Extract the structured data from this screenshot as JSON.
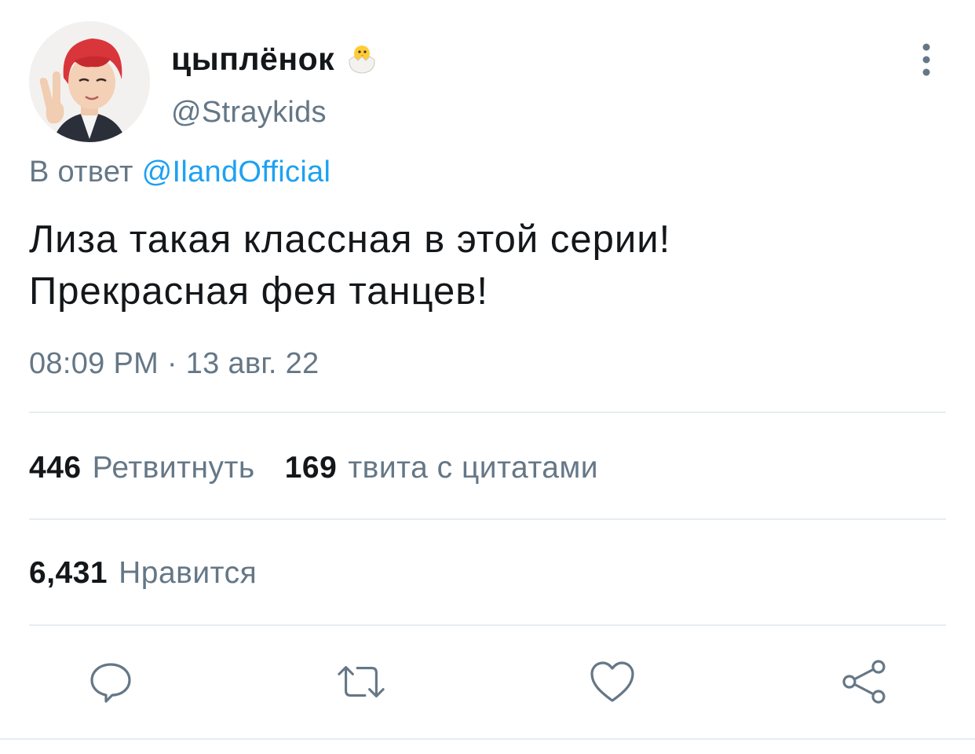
{
  "author": {
    "display_name": "цыплёнок",
    "emoji_icon": "hatching-chick-icon",
    "handle": "@Straykids"
  },
  "reply": {
    "prefix": "В ответ",
    "mention": "@IlandOfficial"
  },
  "tweet": {
    "text_line1": "Лиза такая классная в этой серии!",
    "text_line2": "Прекрасная фея танцев!",
    "timestamp": "08:09 PM · 13 авг. 22"
  },
  "stats": {
    "retweets_count": "446",
    "retweets_label": "Ретвитнуть",
    "quotes_count": "169",
    "quotes_label": "твита с цитатами",
    "likes_count": "6,431",
    "likes_label": "Нравится"
  },
  "actions": {
    "reply_icon": "reply-bubble-icon",
    "retweet_icon": "retweet-icon",
    "like_icon": "heart-icon",
    "share_icon": "share-icon"
  },
  "colors": {
    "text_primary": "#14171a",
    "text_secondary": "#657786",
    "link": "#1da1f2",
    "divider": "#e6ecf0",
    "icon": "#657786"
  }
}
